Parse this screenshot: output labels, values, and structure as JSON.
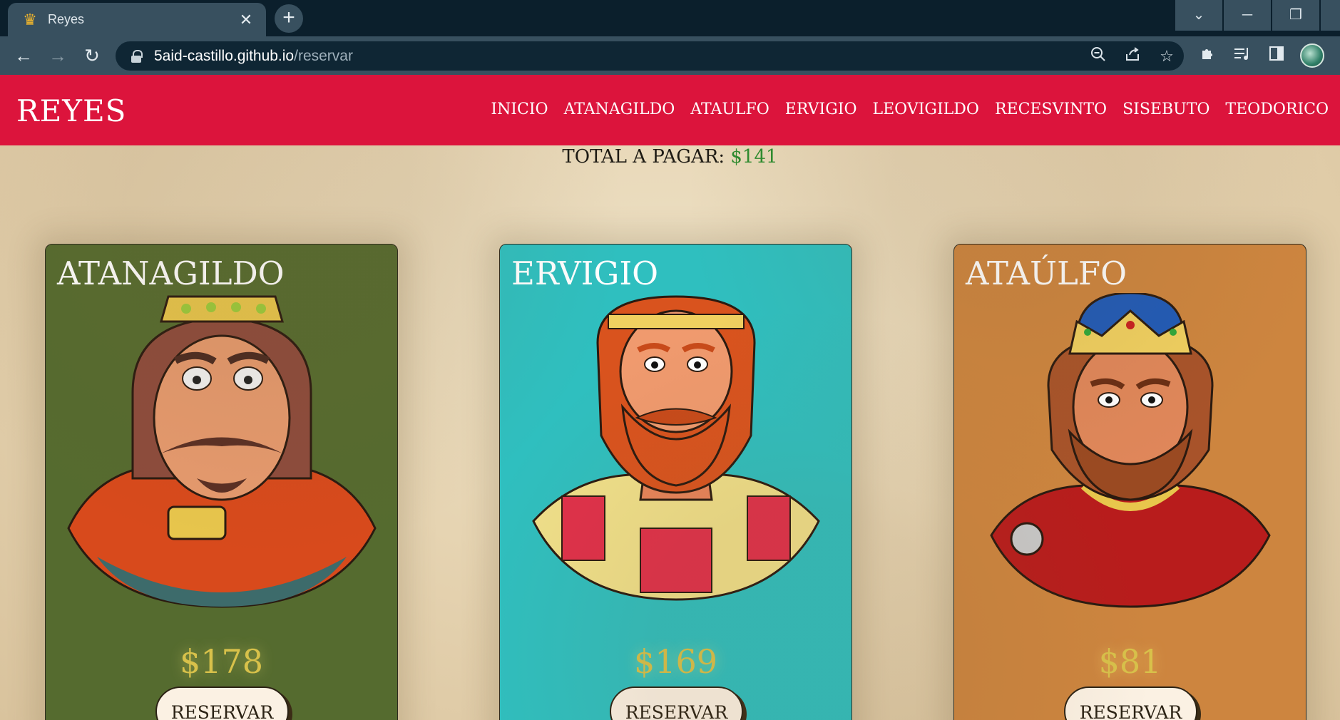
{
  "browser": {
    "tab_title": "Reyes",
    "tab_favicon": "crown-icon",
    "url_host": "5aid-castillo.github.io",
    "url_path": "/reservar"
  },
  "site": {
    "brand": "REYES",
    "nav": [
      "INICIO",
      "ATANAGILDO",
      "ATAULFO",
      "ERVIGIO",
      "LEOVIGILDO",
      "RECESVINTO",
      "SISEBUTO",
      "TEODORICO"
    ],
    "total_label": "TOTAL A PAGAR:",
    "total_value": "$141"
  },
  "cards": [
    {
      "name": "ATANAGILDO",
      "price": "$178",
      "button": "RESERVAR",
      "color": "#556b2f"
    },
    {
      "name": "ERVIGIO",
      "price": "$169",
      "button": "RESERVAR",
      "color": "#2fbfbf"
    },
    {
      "name": "ATAÚLFO",
      "price": "$81",
      "button": "RESERVAR",
      "color": "#cd853f"
    }
  ]
}
